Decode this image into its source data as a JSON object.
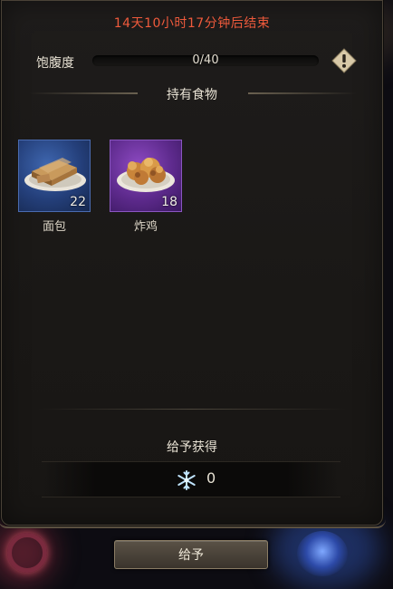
{
  "timer": {
    "text": "14天10小时17分钟后结束",
    "color": "#ef5a3c"
  },
  "satiety": {
    "label": "饱腹度",
    "current": 0,
    "max": 40,
    "text": "0/40",
    "fill_fraction": 0
  },
  "info_icon": "info-diamond-icon",
  "inventory": {
    "title": "持有食物",
    "items": [
      {
        "name": "面包",
        "count": "22",
        "icon": "bread-icon",
        "rarity_color": "#2f4f92"
      },
      {
        "name": "炸鸡",
        "count": "18",
        "icon": "fried-chicken-icon",
        "rarity_color": "#6a2f9e"
      }
    ]
  },
  "reward": {
    "title": "给予获得",
    "icon": "snowflake-icon",
    "value": "0"
  },
  "give_button": {
    "label": "给予"
  }
}
